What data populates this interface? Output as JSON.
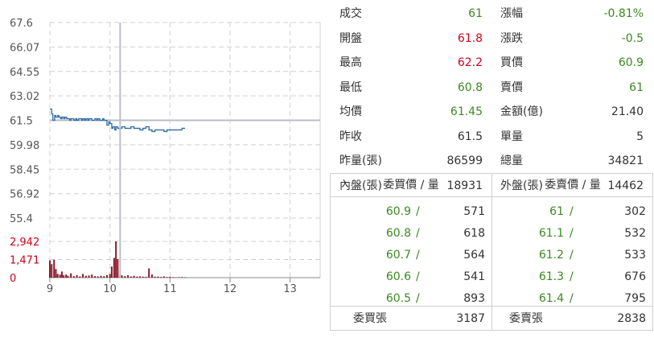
{
  "chart_data": {
    "type": "line",
    "price_axis": {
      "ticks": [
        "67.6",
        "66.07",
        "64.55",
        "63.02",
        "61.5",
        "59.98",
        "58.45",
        "56.92",
        "55.4"
      ],
      "ylim": [
        55.4,
        67.6
      ],
      "reference": 61.5
    },
    "volume_axis": {
      "ticks": [
        "2,942",
        "1,471",
        "0"
      ],
      "ylim": [
        0,
        2942
      ]
    },
    "x_axis": {
      "ticks": [
        "9",
        "10",
        "11",
        "12",
        "13"
      ],
      "xlim": [
        9,
        13.5
      ]
    },
    "cursor_x": 10.17,
    "price_series": {
      "x": [
        9.0,
        9.03,
        9.05,
        9.08,
        9.1,
        9.13,
        9.15,
        9.18,
        9.2,
        9.23,
        9.25,
        9.28,
        9.3,
        9.33,
        9.35,
        9.38,
        9.4,
        9.43,
        9.45,
        9.48,
        9.5,
        9.53,
        9.55,
        9.58,
        9.6,
        9.63,
        9.65,
        9.68,
        9.7,
        9.73,
        9.75,
        9.78,
        9.8,
        9.83,
        9.85,
        9.88,
        9.9,
        9.93,
        9.95,
        9.98,
        10.0,
        10.03,
        10.05,
        10.08,
        10.1,
        10.13,
        10.15,
        10.2,
        10.25,
        10.3,
        10.35,
        10.4,
        10.45,
        10.5,
        10.55,
        10.6,
        10.65,
        10.7,
        10.75,
        10.8,
        10.85,
        10.9,
        10.95,
        11.0,
        11.05,
        11.1,
        11.15,
        11.2,
        11.25
      ],
      "y": [
        62.2,
        61.9,
        61.5,
        61.8,
        61.7,
        61.8,
        61.7,
        61.6,
        61.7,
        61.6,
        61.7,
        61.6,
        61.6,
        61.5,
        61.6,
        61.6,
        61.5,
        61.6,
        61.5,
        61.6,
        61.6,
        61.5,
        61.6,
        61.5,
        61.6,
        61.5,
        61.6,
        61.6,
        61.5,
        61.5,
        61.6,
        61.5,
        61.6,
        61.5,
        61.5,
        61.6,
        61.5,
        61.5,
        61.2,
        61.4,
        61.3,
        61.0,
        61.1,
        60.9,
        61.1,
        61.0,
        61.0,
        61.1,
        61.0,
        61.0,
        61.1,
        61.0,
        61.0,
        60.9,
        61.0,
        61.1,
        60.9,
        60.8,
        60.9,
        60.9,
        60.9,
        60.8,
        60.9,
        60.9,
        60.9,
        60.9,
        60.9,
        61.0,
        61.0
      ]
    },
    "volume_series": {
      "x": [
        9.0,
        9.03,
        9.07,
        9.1,
        9.13,
        9.17,
        9.2,
        9.23,
        9.27,
        9.3,
        9.35,
        9.4,
        9.45,
        9.5,
        9.55,
        9.6,
        9.65,
        9.7,
        9.75,
        9.8,
        9.85,
        9.9,
        9.95,
        10.0,
        10.03,
        10.07,
        10.1,
        10.13,
        10.17,
        10.2,
        10.25,
        10.3,
        10.35,
        10.4,
        10.45,
        10.5,
        10.55,
        10.6,
        10.65,
        10.7,
        10.75,
        10.8,
        10.85,
        10.9,
        10.95,
        11.0,
        11.05,
        11.1,
        11.15,
        11.2,
        11.25
      ],
      "y": [
        1400,
        1100,
        1450,
        700,
        300,
        250,
        500,
        200,
        250,
        150,
        350,
        120,
        200,
        100,
        300,
        150,
        180,
        250,
        120,
        100,
        150,
        110,
        200,
        300,
        900,
        1600,
        2942,
        1500,
        250,
        180,
        120,
        200,
        100,
        150,
        90,
        110,
        80,
        70,
        750,
        250,
        80,
        90,
        60,
        100,
        50,
        70,
        40,
        30,
        40,
        50,
        30
      ]
    }
  },
  "quote": {
    "rows": [
      {
        "l_label": "成交",
        "l_value": "61",
        "l_color": "green",
        "r_label": "漲幅",
        "r_value": "-0.81%",
        "r_color": "green"
      },
      {
        "l_label": "開盤",
        "l_value": "61.8",
        "l_color": "red",
        "r_label": "漲跌",
        "r_value": "-0.5",
        "r_color": "green"
      },
      {
        "l_label": "最高",
        "l_value": "62.2",
        "l_color": "red",
        "r_label": "買價",
        "r_value": "60.9",
        "r_color": "green"
      },
      {
        "l_label": "最低",
        "l_value": "60.8",
        "l_color": "green",
        "r_label": "賣價",
        "r_value": "61",
        "r_color": "green"
      },
      {
        "l_label": "均價",
        "l_value": "61.45",
        "l_color": "green",
        "r_label": "金額(億)",
        "r_value": "21.40",
        "r_color": "dark"
      },
      {
        "l_label": "昨收",
        "l_value": "61.5",
        "l_color": "dark",
        "r_label": "單量",
        "r_value": "5",
        "r_color": "dark"
      },
      {
        "l_label": "昨量(張)",
        "l_value": "86599",
        "l_color": "dark",
        "r_label": "總量",
        "r_value": "34821",
        "r_color": "dark"
      },
      {
        "l_label": "內盤(張)",
        "l_value": "18931",
        "l_color": "dark",
        "r_label": "外盤(張)",
        "r_value": "14462",
        "r_color": "dark"
      }
    ]
  },
  "order_book": {
    "bid_header": "委買價 / 量",
    "ask_header": "委賣價 / 量",
    "slash": "/",
    "bids": [
      {
        "price": "60.9",
        "qty": "571"
      },
      {
        "price": "60.8",
        "qty": "618"
      },
      {
        "price": "60.7",
        "qty": "564"
      },
      {
        "price": "60.6",
        "qty": "541"
      },
      {
        "price": "60.5",
        "qty": "893"
      }
    ],
    "asks": [
      {
        "price": "61",
        "qty": "302"
      },
      {
        "price": "61.1",
        "qty": "532"
      },
      {
        "price": "61.2",
        "qty": "533"
      },
      {
        "price": "61.3",
        "qty": "676"
      },
      {
        "price": "61.4",
        "qty": "795"
      }
    ],
    "bid_total_label": "委買張",
    "bid_total": "3187",
    "ask_total_label": "委賣張",
    "ask_total": "2838"
  },
  "colors": {
    "price_line": "#2e6ba8",
    "reference_line": "#b8bec6",
    "volume_bar": "#8b1a2b",
    "grid": "#d0d0d0",
    "green": "#3a8a1f",
    "red": "#d0021b"
  }
}
